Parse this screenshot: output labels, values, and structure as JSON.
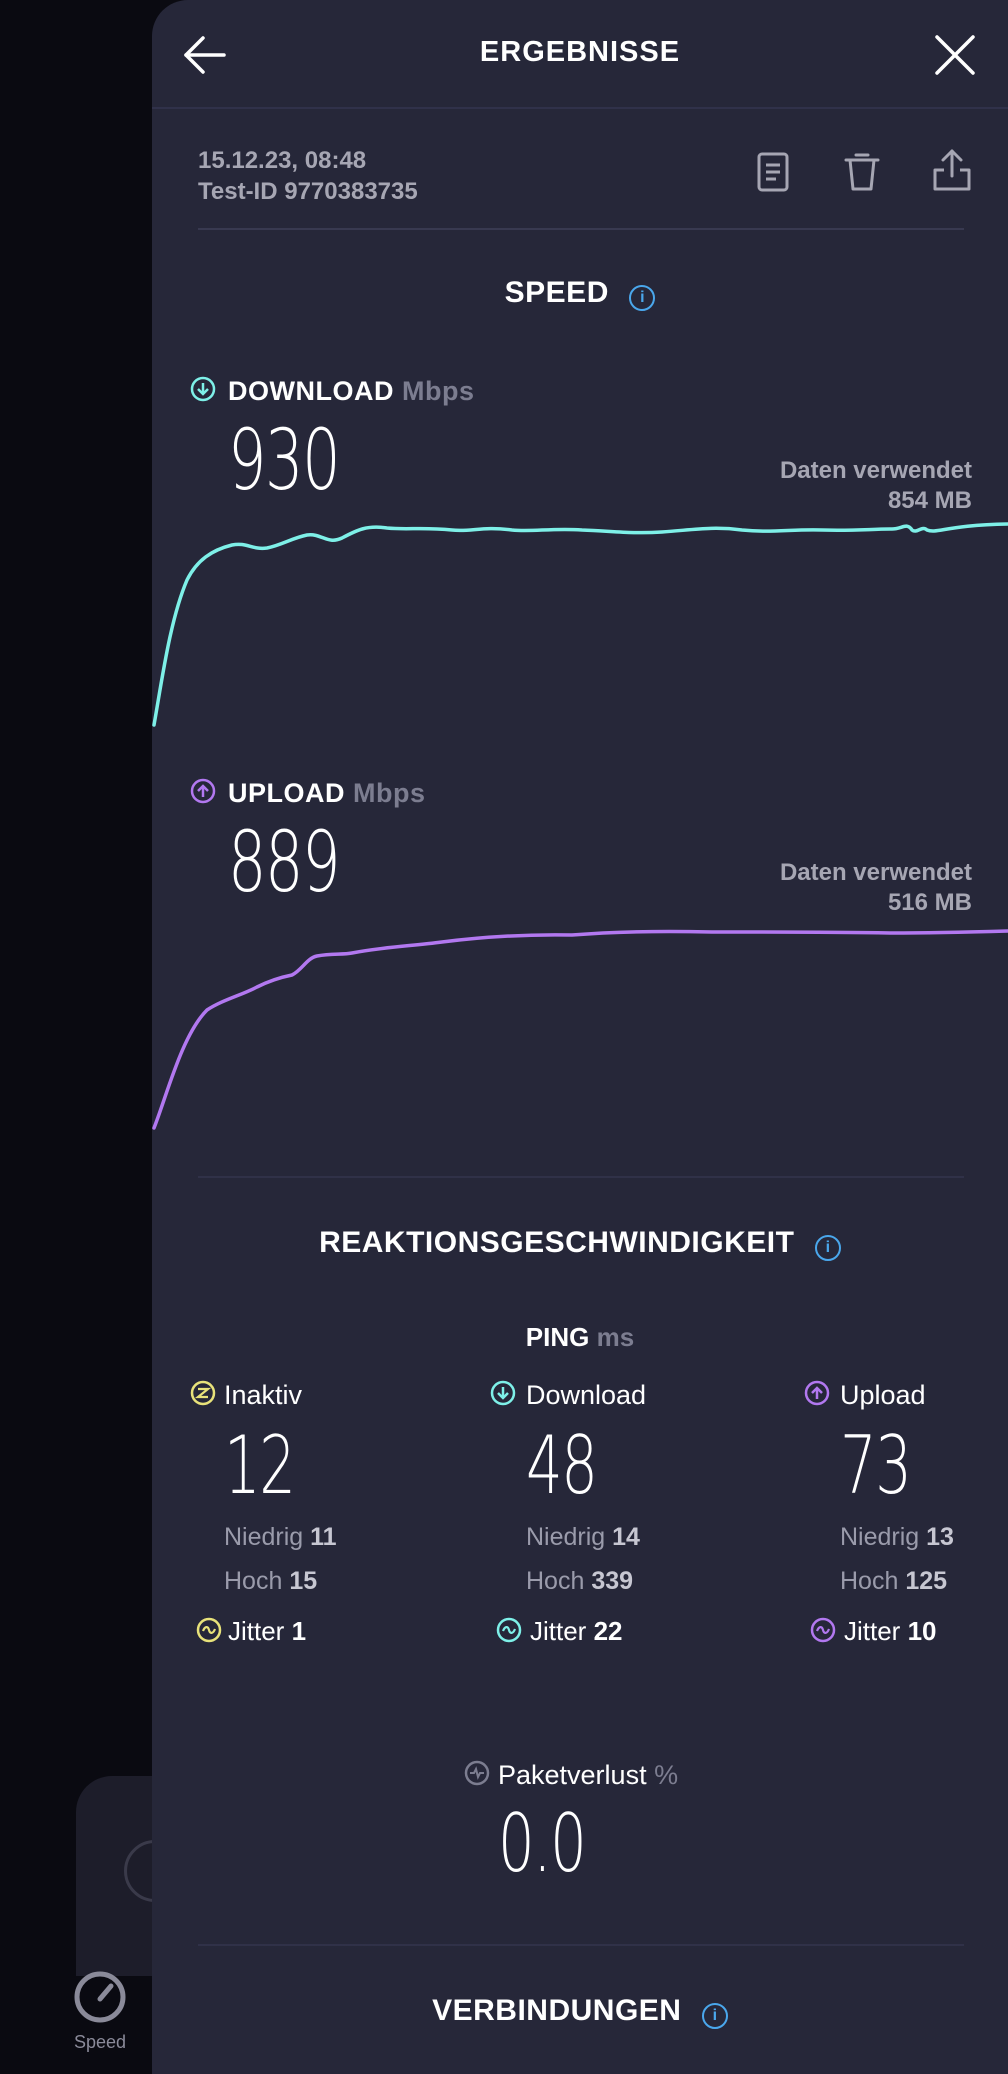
{
  "header": {
    "title": "ERGEBNISSE"
  },
  "test": {
    "date": "15.12.23, 08:48",
    "test_id": "Test-ID 9770383735"
  },
  "speed": {
    "title": "SPEED",
    "download": {
      "label": "DOWNLOAD",
      "unit": "Mbps",
      "value": "930",
      "data_used_label": "Daten verwendet",
      "data_used_value": "854 MB",
      "color": "#7ef0e8"
    },
    "upload": {
      "label": "UPLOAD",
      "unit": "Mbps",
      "value": "889",
      "data_used_label": "Daten verwendet",
      "data_used_value": "516 MB",
      "color": "#b278f0"
    }
  },
  "responsiveness": {
    "title": "REAKTIONSGESCHWINDIGKEIT",
    "ping_label": "PING",
    "ping_unit": "ms",
    "low_label": "Niedrig",
    "high_label": "Hoch",
    "jitter_label": "Jitter",
    "columns": [
      {
        "title": "Inaktiv",
        "value": "12",
        "low": "11",
        "high": "15",
        "jitter": "1",
        "color": "#e8e27a"
      },
      {
        "title": "Download",
        "value": "48",
        "low": "14",
        "high": "339",
        "jitter": "22",
        "color": "#7ef0e8"
      },
      {
        "title": "Upload",
        "value": "73",
        "low": "13",
        "high": "125",
        "jitter": "10",
        "color": "#b278f0"
      }
    ],
    "packet_loss": {
      "label": "Paketverlust",
      "unit": "%",
      "value": "0.0"
    }
  },
  "connections": {
    "title": "VERBINDUNGEN"
  },
  "bottom_nav": {
    "speed_label": "Speed"
  }
}
